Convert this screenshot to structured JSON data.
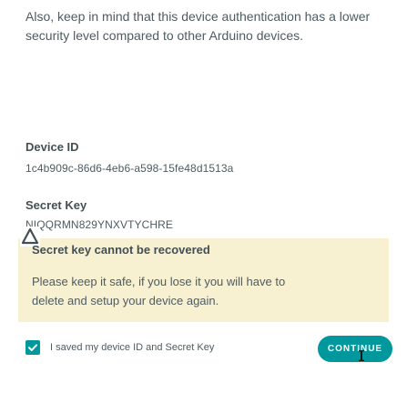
{
  "intro": {
    "text": "Also, keep in mind that this device authentication has a lower security level compared to other Arduino devices."
  },
  "device_id": {
    "label": "Device ID",
    "value": "1c4b909c-86d6-4eb6-a598-15fe48d1513a"
  },
  "secret_key": {
    "label": "Secret Key",
    "value": "NIQQRMN829YNXVTYCHRE"
  },
  "warning": {
    "icon": "warning-triangle-icon",
    "title": "Secret key cannot be recovered",
    "text": "Please keep it safe, if you lose it you will have to delete and setup your device again."
  },
  "footer": {
    "checkbox_label": "I saved my device ID and Secret Key",
    "checkbox_checked": true,
    "continue_label": "CONTINUE"
  },
  "colors": {
    "accent": "#00979d",
    "warning_bg": "#f7f1d2",
    "text": "#4e5b61",
    "heading": "#434f54"
  }
}
